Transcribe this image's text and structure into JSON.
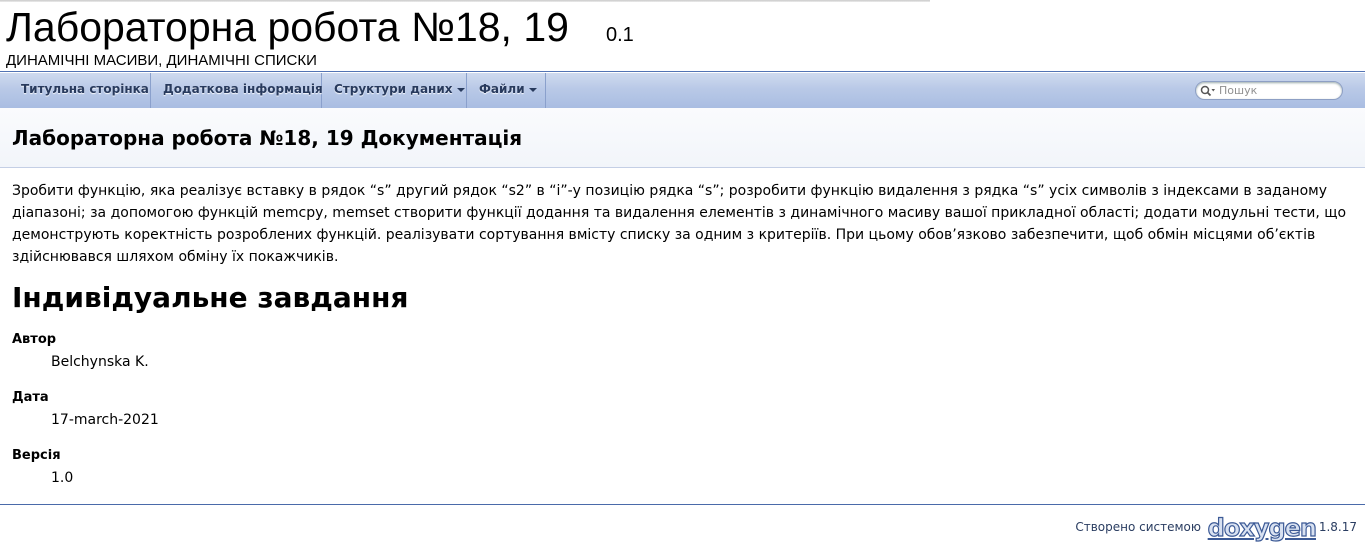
{
  "project": {
    "name": "Лабораторна робота №18, 19",
    "number": "0.1",
    "brief": "ДИНАМІЧНІ МАСИВИ, ДИНАМІЧНІ СПИСКИ"
  },
  "navbar": {
    "items": [
      {
        "label": "Титульна сторінка"
      },
      {
        "label": "Додаткова інформація"
      },
      {
        "label": "Структури даних",
        "dropdown": true
      },
      {
        "label": "Файли",
        "dropdown": true
      }
    ],
    "search": {
      "placeholder": "Пошук",
      "icon": "search-icon"
    }
  },
  "header": {
    "title": "Лабораторна робота №18, 19 Документація"
  },
  "main": {
    "description_lines": [
      "Зробити функцію, яка реалізує вставку в рядок “s” другий рядок “s2” в “i”-у позицію рядка “s”; розробити функцію видалення з рядка “s” усіх символів з індексами в заданому",
      "діапазоні; за допомогою функцій memcpy, memset створити функції додання та видалення елементів з динамічного масиву вашої прикладної області; додати модульні тести, що",
      "демонструють коректність розроблених функцій. реалізувати сортування вмісту списку за одним з критеріїв. При цьому обов’язково забезпечити, щоб обмін місцями об’єктів",
      "здійснювався шляхом обміну їх покажчиків."
    ],
    "section_title": "Індивідуальне завдання",
    "fields": [
      {
        "label": "Автор",
        "value": "Belchynska K."
      },
      {
        "label": "Дата",
        "value": "17-march-2021"
      },
      {
        "label": "Версія",
        "value": "1.0"
      }
    ]
  },
  "footer": {
    "generated_by": "Створено системою",
    "logo_text": "doxygen",
    "version": "1.8.17"
  }
}
